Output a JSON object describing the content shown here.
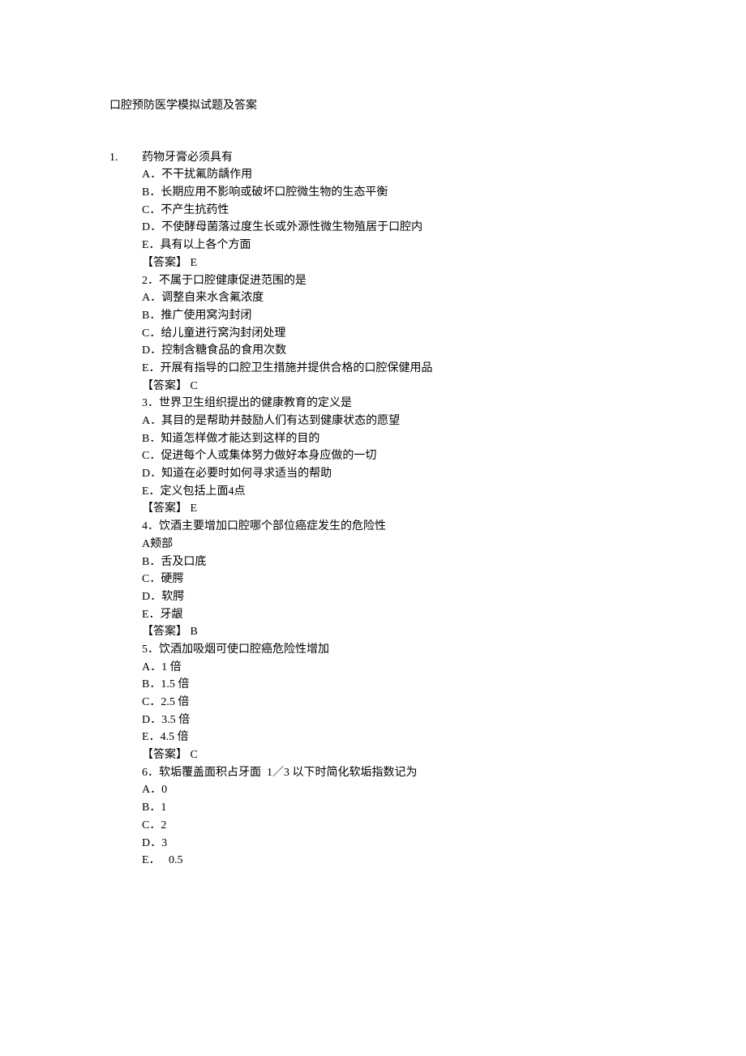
{
  "title": "口腔预防医学模拟试题及答案",
  "q1": {
    "num": "1.",
    "stem": "药物牙膏必须具有",
    "opts": [
      "A．不干扰氟防龋作用",
      "B．长期应用不影响或破坏口腔微生物的生态平衡",
      "C．不产生抗药性",
      "D．不使酵母菌落过度生长或外源性微生物殖居于口腔内",
      "E．具有以上各个方面"
    ],
    "ans": "【答案】 E"
  },
  "q2": {
    "stem": "2．不属于口腔健康促进范围的是",
    "opts": [
      "A．调整自来水含氟浓度",
      "B．推广使用窝沟封闭",
      "C．给儿童进行窝沟封闭处理",
      "D．控制含糖食品的食用次数",
      "E．开展有指导的口腔卫生措施并提供合格的口腔保健用品"
    ],
    "ans": "【答案】 C"
  },
  "q3": {
    "stem": "3．世界卫生组织提出的健康教育的定义是",
    "opts": [
      "A．其目的是帮助并鼓励人们有达到健康状态的愿望",
      "B．知道怎样做才能达到这样的目的",
      "C．促进每个人或集体努力做好本身应做的一切",
      "D．知道在必要时如何寻求适当的帮助",
      "E．定义包括上面4点"
    ],
    "ans": "【答案】 E"
  },
  "q4": {
    "stem": "4．饮酒主要增加口腔哪个部位癌症发生的危险性",
    "opts": [
      "A颊部",
      "B．舌及口底",
      "C．硬腭",
      "D．软腭",
      "E．牙龈"
    ],
    "ans": "【答案】 B"
  },
  "q5": {
    "stem": "5．饮酒加吸烟可使口腔癌危险性增加",
    "opts": [
      "A．1 倍",
      "B．1.5 倍",
      "C．2.5 倍",
      "D．3.5 倍",
      "E．4.5 倍"
    ],
    "ans": "【答案】 C"
  },
  "q6": {
    "stem": "6．软垢覆盖面积占牙面  1／3 以下时简化软垢指数记为",
    "opts": [
      "A．0",
      "B．1",
      "C．2",
      "D．3",
      "E．　 0.5"
    ]
  }
}
